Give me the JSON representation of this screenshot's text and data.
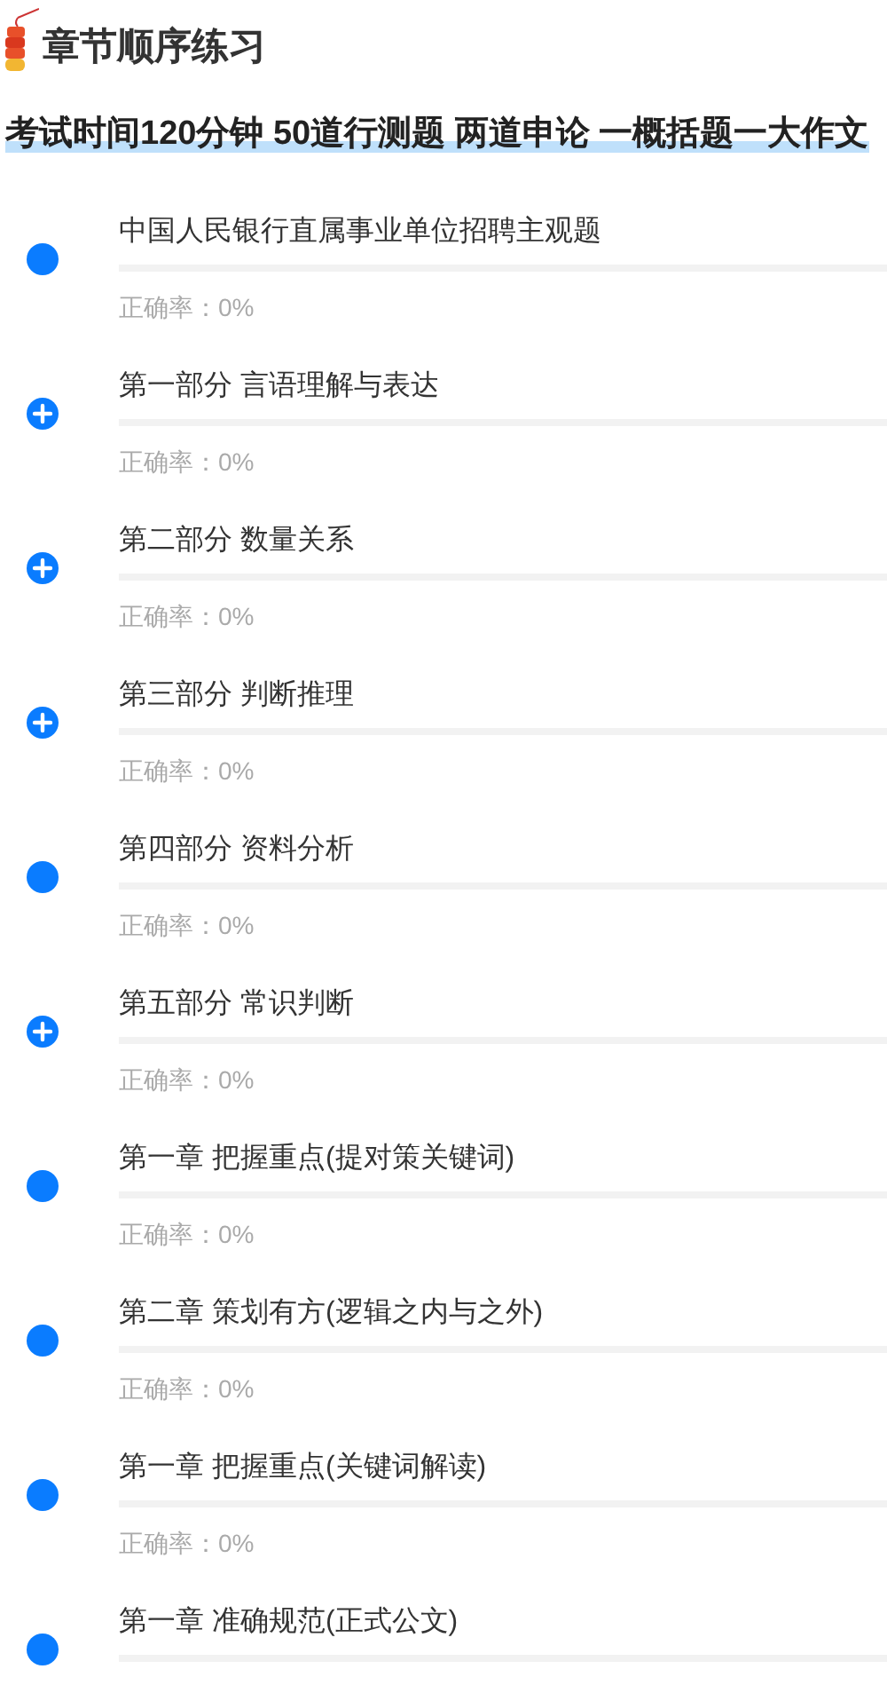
{
  "header": {
    "title": "章节顺序练习",
    "subtitle": "考试时间120分钟 50道行测题 两道申论 一概括题一大作文"
  },
  "chapters": [
    {
      "kind": "leaf",
      "title": "中国人民银行直属事业单位招聘主观题",
      "accuracy": "正确率：0%"
    },
    {
      "kind": "expandable",
      "title": "第一部分 言语理解与表达",
      "accuracy": "正确率：0%"
    },
    {
      "kind": "expandable",
      "title": "第二部分 数量关系",
      "accuracy": "正确率：0%"
    },
    {
      "kind": "expandable",
      "title": "第三部分 判断推理",
      "accuracy": "正确率：0%"
    },
    {
      "kind": "leaf",
      "title": "第四部分 资料分析",
      "accuracy": "正确率：0%"
    },
    {
      "kind": "expandable",
      "title": "第五部分 常识判断",
      "accuracy": "正确率：0%"
    },
    {
      "kind": "leaf",
      "title": "第一章 把握重点(提对策关键词)",
      "accuracy": "正确率：0%"
    },
    {
      "kind": "leaf",
      "title": "第二章 策划有方(逻辑之内与之外)",
      "accuracy": "正确率：0%"
    },
    {
      "kind": "leaf",
      "title": "第一章 把握重点(关键词解读)",
      "accuracy": "正确率：0%"
    },
    {
      "kind": "leaf",
      "title": "第一章 准确规范(正式公文)"
    }
  ]
}
